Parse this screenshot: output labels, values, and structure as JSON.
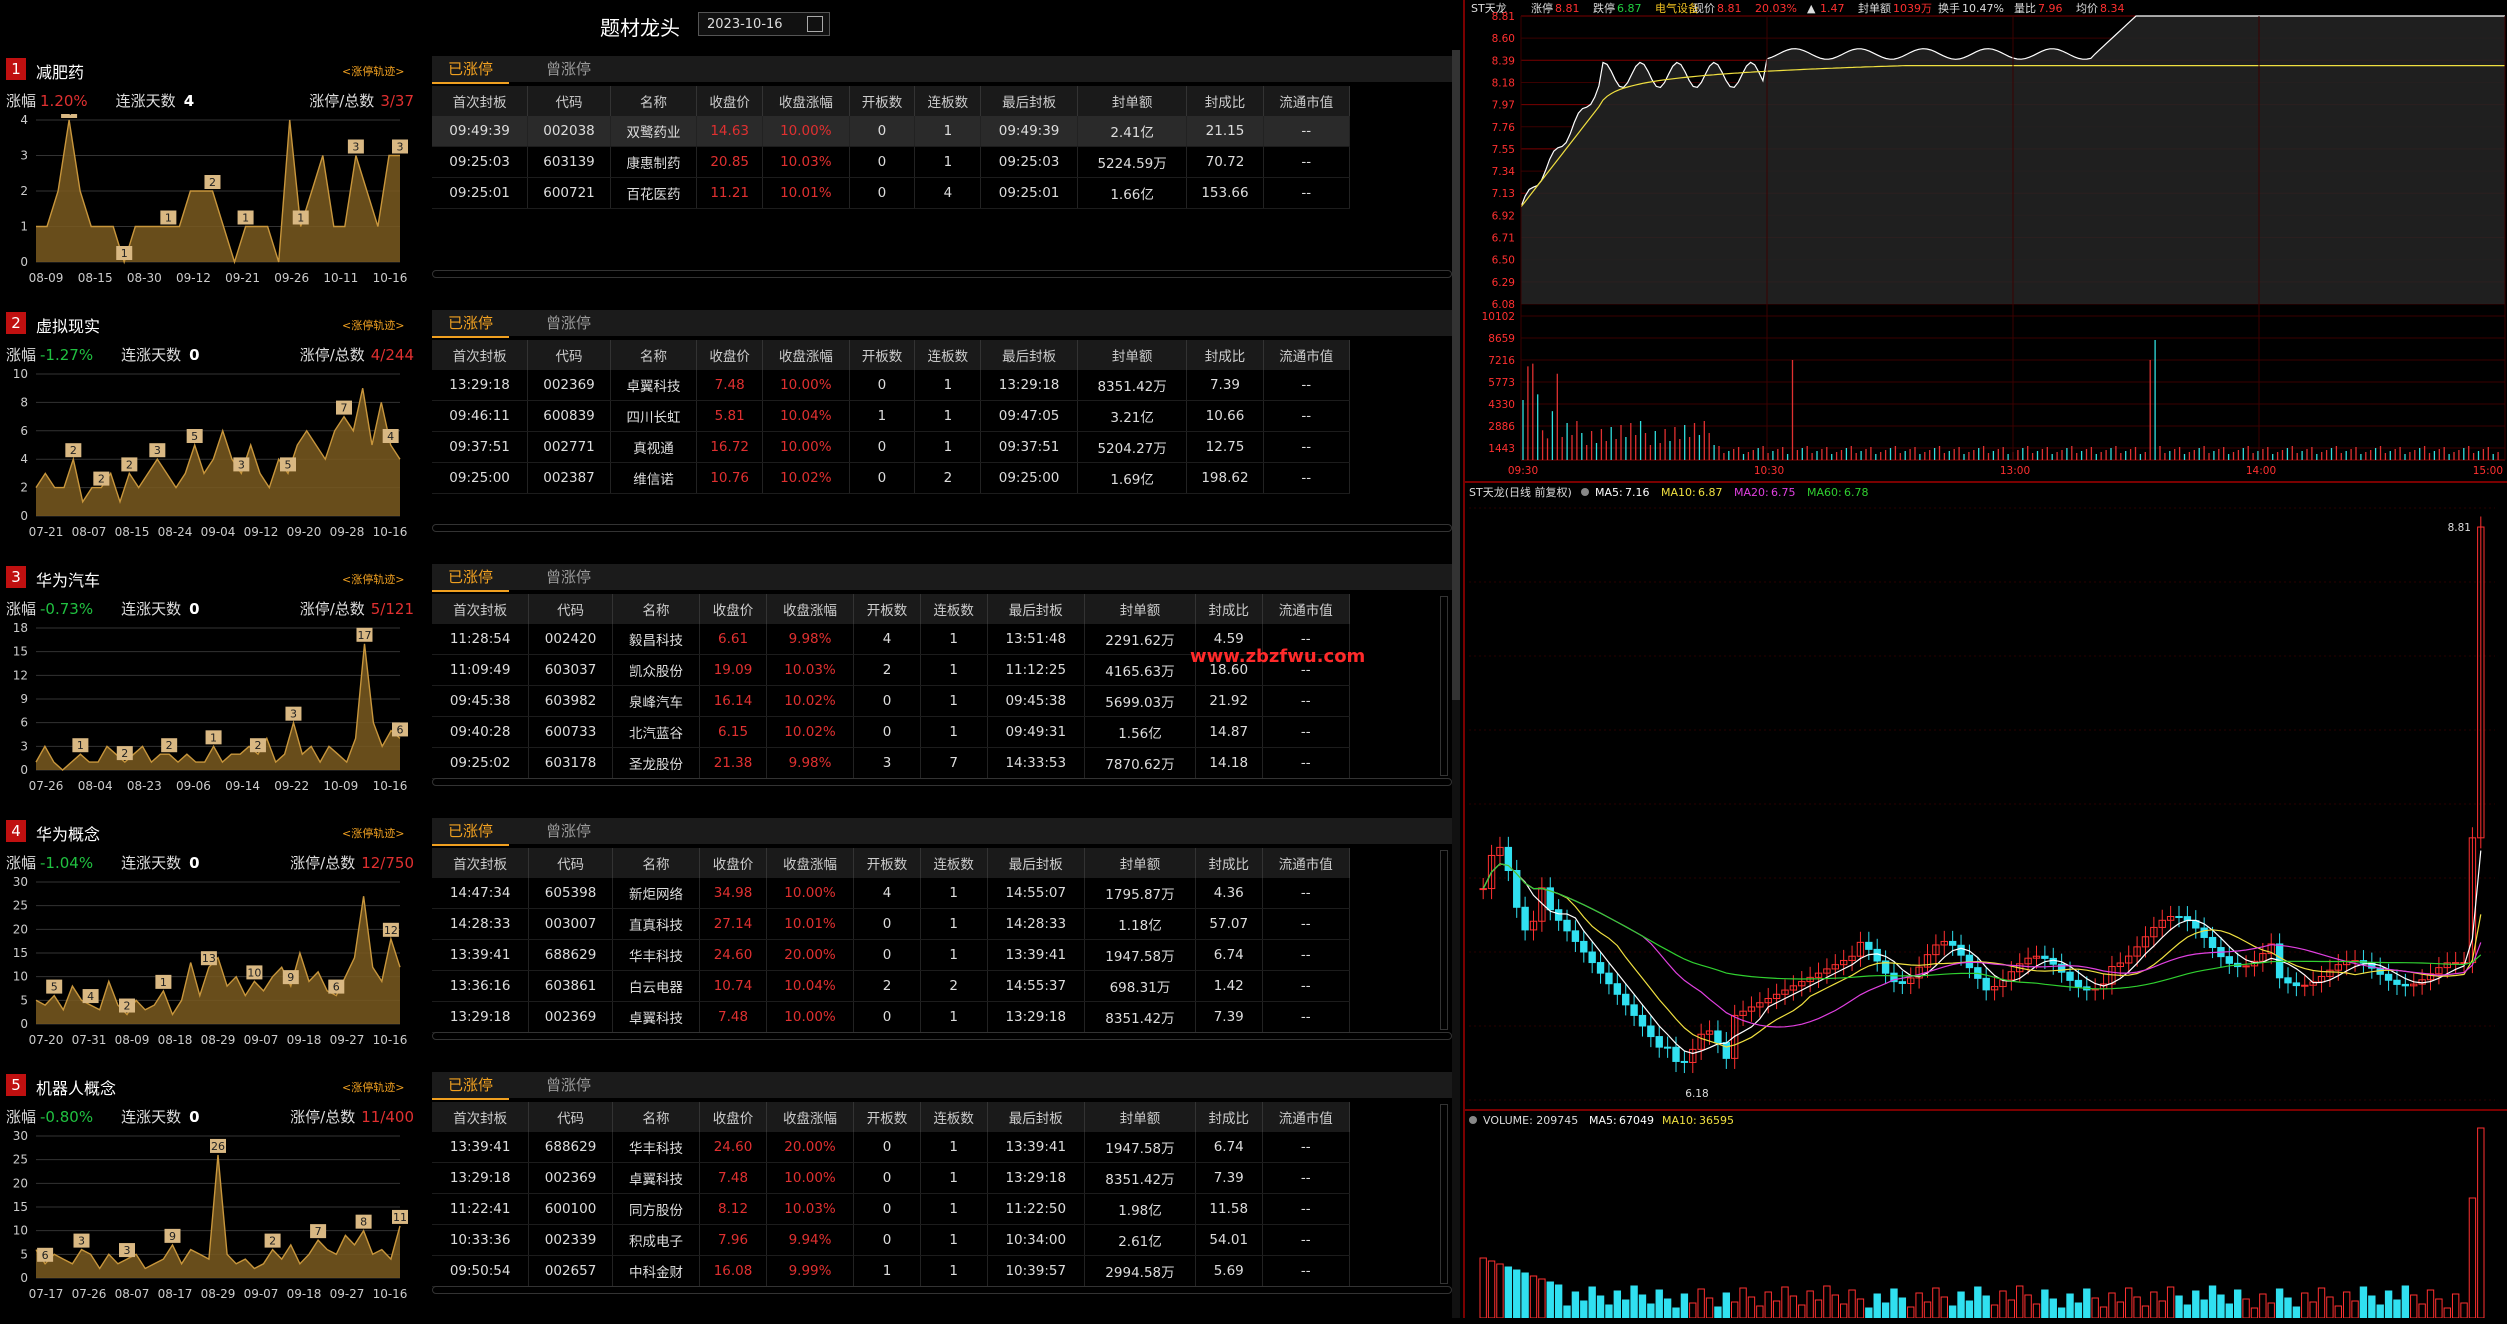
{
  "page": {
    "title": "题材龙头",
    "date": "2023-10-16"
  },
  "tabs": {
    "active": "已涨停",
    "inactive": "曾涨停"
  },
  "track_label": "<涨停轨迹>",
  "labels": {
    "chg": "涨幅",
    "days": "连涨天数",
    "ratio": "涨停/总数"
  },
  "table_headers": [
    "首次封板",
    "代码",
    "名称",
    "收盘价",
    "收盘涨幅",
    "开板数",
    "连板数",
    "最后封板",
    "封单额",
    "封成比",
    "流通市值"
  ],
  "concepts": [
    {
      "rank": "1",
      "name": "减肥药",
      "chg": "1.20%",
      "chg_dir": "up",
      "days": "4",
      "ratio": "3/37",
      "mini": {
        "ylim": [
          0,
          4
        ],
        "yticks": [
          "0",
          "1",
          "2",
          "3",
          "4"
        ],
        "xticks": [
          "08-09",
          "08-15",
          "08-30",
          "09-12",
          "09-21",
          "09-26",
          "10-11",
          "10-16"
        ],
        "values": [
          1,
          1,
          2,
          4,
          2,
          1,
          1,
          1,
          0,
          1,
          1,
          1,
          1,
          1,
          2,
          2,
          2,
          1,
          0,
          1,
          1,
          1,
          0,
          4,
          1,
          2,
          3,
          1,
          1,
          3,
          2,
          1,
          3,
          3
        ],
        "marks": [
          {
            "i": 3,
            "v": "4"
          },
          {
            "i": 8,
            "v": "1"
          },
          {
            "i": 12,
            "v": "1"
          },
          {
            "i": 16,
            "v": "2"
          },
          {
            "i": 19,
            "v": "1"
          },
          {
            "i": 24,
            "v": "1"
          },
          {
            "i": 29,
            "v": "3"
          },
          {
            "i": 33,
            "v": "3"
          }
        ]
      },
      "rows": [
        [
          "09:49:39",
          "002038",
          "双鹭药业",
          "14.63",
          "10.00%",
          "0",
          "1",
          "09:49:39",
          "2.41亿",
          "21.15",
          "--"
        ],
        [
          "09:25:03",
          "603139",
          "康惠制药",
          "20.85",
          "10.03%",
          "0",
          "1",
          "09:25:03",
          "5224.59万",
          "70.72",
          "--"
        ],
        [
          "09:25:01",
          "600721",
          "百花医药",
          "11.21",
          "10.01%",
          "0",
          "4",
          "09:25:01",
          "1.66亿",
          "153.66",
          "--"
        ]
      ]
    },
    {
      "rank": "2",
      "name": "虚拟现实",
      "chg": "-1.27%",
      "chg_dir": "down",
      "days": "0",
      "ratio": "4/244",
      "mini": {
        "ylim": [
          0,
          10
        ],
        "yticks": [
          "0",
          "2",
          "4",
          "6",
          "8",
          "10"
        ],
        "xticks": [
          "07-21",
          "08-07",
          "08-15",
          "08-24",
          "09-04",
          "09-12",
          "09-20",
          "09-28",
          "10-16"
        ],
        "values": [
          2,
          3,
          2,
          2,
          4,
          1,
          2,
          2,
          3,
          1,
          3,
          2,
          3,
          4,
          3,
          2,
          3,
          5,
          3,
          4,
          6,
          4,
          3,
          5,
          3,
          2,
          4,
          3,
          5,
          6,
          5,
          4,
          6,
          7,
          6,
          9,
          5,
          8,
          5,
          4
        ],
        "marks": [
          {
            "i": 4,
            "v": "2"
          },
          {
            "i": 7,
            "v": "2"
          },
          {
            "i": 10,
            "v": "2"
          },
          {
            "i": 13,
            "v": "3"
          },
          {
            "i": 17,
            "v": "5"
          },
          {
            "i": 22,
            "v": "3"
          },
          {
            "i": 27,
            "v": "5"
          },
          {
            "i": 33,
            "v": "7"
          },
          {
            "i": 38,
            "v": "4"
          }
        ]
      },
      "rows": [
        [
          "13:29:18",
          "002369",
          "卓翼科技",
          "7.48",
          "10.00%",
          "0",
          "1",
          "13:29:18",
          "8351.42万",
          "7.39",
          "--"
        ],
        [
          "09:46:11",
          "600839",
          "四川长虹",
          "5.81",
          "10.04%",
          "1",
          "1",
          "09:47:05",
          "3.21亿",
          "10.66",
          "--"
        ],
        [
          "09:37:51",
          "002771",
          "真视通",
          "16.72",
          "10.00%",
          "0",
          "1",
          "09:37:51",
          "5204.27万",
          "12.75",
          "--"
        ],
        [
          "09:25:00",
          "002387",
          "维信诺",
          "10.76",
          "10.02%",
          "0",
          "2",
          "09:25:00",
          "1.69亿",
          "198.62",
          "--"
        ]
      ]
    },
    {
      "rank": "3",
      "name": "华为汽车",
      "chg": "-0.73%",
      "chg_dir": "down",
      "days": "0",
      "ratio": "5/121",
      "mini": {
        "ylim": [
          0,
          18
        ],
        "yticks": [
          "0",
          "3",
          "6",
          "9",
          "12",
          "15",
          "18"
        ],
        "xticks": [
          "07-26",
          "08-04",
          "08-23",
          "09-06",
          "09-14",
          "09-22",
          "10-09",
          "10-16"
        ],
        "values": [
          1,
          3,
          1,
          0,
          1,
          2,
          1,
          1,
          3,
          2,
          1,
          2,
          3,
          1,
          2,
          2,
          1,
          2,
          1,
          1,
          3,
          1,
          2,
          2,
          3,
          2,
          4,
          1,
          2,
          6,
          2,
          3,
          1,
          3,
          2,
          1,
          4,
          16,
          6,
          3,
          5,
          4
        ],
        "marks": [
          {
            "i": 5,
            "v": "1"
          },
          {
            "i": 10,
            "v": "2"
          },
          {
            "i": 15,
            "v": "2"
          },
          {
            "i": 20,
            "v": "1"
          },
          {
            "i": 25,
            "v": "2"
          },
          {
            "i": 29,
            "v": "3"
          },
          {
            "i": 37,
            "v": "17"
          },
          {
            "i": 41,
            "v": "6"
          }
        ]
      },
      "rows": [
        [
          "11:28:54",
          "002420",
          "毅昌科技",
          "6.61",
          "9.98%",
          "4",
          "1",
          "13:51:48",
          "2291.62万",
          "4.59",
          "--"
        ],
        [
          "11:09:49",
          "603037",
          "凯众股份",
          "19.09",
          "10.03%",
          "2",
          "1",
          "11:12:25",
          "4165.63万",
          "18.60",
          "--"
        ],
        [
          "09:45:38",
          "603982",
          "泉峰汽车",
          "16.14",
          "10.02%",
          "0",
          "1",
          "09:45:38",
          "5699.03万",
          "21.92",
          "--"
        ],
        [
          "09:40:28",
          "600733",
          "北汽蓝谷",
          "6.15",
          "10.02%",
          "0",
          "1",
          "09:49:31",
          "1.56亿",
          "14.87",
          "--"
        ],
        [
          "09:25:02",
          "603178",
          "圣龙股份",
          "21.38",
          "9.98%",
          "3",
          "7",
          "14:33:53",
          "7870.62万",
          "14.18",
          "--"
        ]
      ]
    },
    {
      "rank": "4",
      "name": "华为概念",
      "chg": "-1.04%",
      "chg_dir": "down",
      "days": "0",
      "ratio": "12/750",
      "mini": {
        "ylim": [
          0,
          30
        ],
        "yticks": [
          "0",
          "5",
          "10",
          "15",
          "20",
          "25",
          "30"
        ],
        "xticks": [
          "07-20",
          "07-31",
          "08-09",
          "08-18",
          "08-29",
          "09-07",
          "09-18",
          "09-27",
          "10-16"
        ],
        "values": [
          5,
          4,
          6,
          3,
          8,
          5,
          4,
          3,
          9,
          4,
          2,
          5,
          3,
          4,
          7,
          2,
          5,
          13,
          6,
          12,
          14,
          8,
          10,
          6,
          9,
          7,
          10,
          12,
          8,
          15,
          9,
          11,
          7,
          6,
          10,
          14,
          27,
          12,
          9,
          18,
          12
        ],
        "marks": [
          {
            "i": 2,
            "v": "5"
          },
          {
            "i": 6,
            "v": "4"
          },
          {
            "i": 10,
            "v": "2"
          },
          {
            "i": 14,
            "v": "1"
          },
          {
            "i": 19,
            "v": "13"
          },
          {
            "i": 24,
            "v": "10"
          },
          {
            "i": 28,
            "v": "9"
          },
          {
            "i": 33,
            "v": "6"
          },
          {
            "i": 39,
            "v": "12"
          }
        ]
      },
      "rows": [
        [
          "14:47:34",
          "605398",
          "新炬网络",
          "34.98",
          "10.00%",
          "4",
          "1",
          "14:55:07",
          "1795.87万",
          "4.36",
          "--"
        ],
        [
          "14:28:33",
          "003007",
          "直真科技",
          "27.14",
          "10.01%",
          "0",
          "1",
          "14:28:33",
          "1.18亿",
          "57.07",
          "--"
        ],
        [
          "13:39:41",
          "688629",
          "华丰科技",
          "24.60",
          "20.00%",
          "0",
          "1",
          "13:39:41",
          "1947.58万",
          "6.74",
          "--"
        ],
        [
          "13:36:16",
          "603861",
          "白云电器",
          "10.74",
          "10.04%",
          "2",
          "2",
          "14:55:37",
          "698.31万",
          "1.42",
          "--"
        ],
        [
          "13:29:18",
          "002369",
          "卓翼科技",
          "7.48",
          "10.00%",
          "0",
          "1",
          "13:29:18",
          "8351.42万",
          "7.39",
          "--"
        ]
      ]
    },
    {
      "rank": "5",
      "name": "机器人概念",
      "chg": "-0.80%",
      "chg_dir": "down",
      "days": "0",
      "ratio": "11/400",
      "mini": {
        "ylim": [
          0,
          30
        ],
        "yticks": [
          "0",
          "5",
          "10",
          "15",
          "20",
          "25",
          "30"
        ],
        "xticks": [
          "07-17",
          "07-26",
          "08-07",
          "08-17",
          "08-29",
          "09-07",
          "09-18",
          "09-27",
          "10-16"
        ],
        "values": [
          6,
          3,
          5,
          4,
          3,
          6,
          5,
          2,
          5,
          3,
          4,
          5,
          2,
          3,
          4,
          7,
          3,
          6,
          5,
          4,
          26,
          5,
          3,
          4,
          2,
          3,
          6,
          4,
          7,
          3,
          5,
          8,
          6,
          5,
          9,
          7,
          10,
          5,
          6,
          4,
          11
        ],
        "marks": [
          {
            "i": 1,
            "v": "6"
          },
          {
            "i": 5,
            "v": "3"
          },
          {
            "i": 10,
            "v": "3"
          },
          {
            "i": 15,
            "v": "9"
          },
          {
            "i": 20,
            "v": "26"
          },
          {
            "i": 26,
            "v": "2"
          },
          {
            "i": 31,
            "v": "7"
          },
          {
            "i": 36,
            "v": "8"
          },
          {
            "i": 40,
            "v": "11"
          }
        ]
      },
      "rows": [
        [
          "13:39:41",
          "688629",
          "华丰科技",
          "24.60",
          "20.00%",
          "0",
          "1",
          "13:39:41",
          "1947.58万",
          "6.74",
          "--"
        ],
        [
          "13:29:18",
          "002369",
          "卓翼科技",
          "7.48",
          "10.00%",
          "0",
          "1",
          "13:29:18",
          "8351.42万",
          "7.39",
          "--"
        ],
        [
          "11:22:41",
          "600100",
          "同方股份",
          "8.12",
          "10.03%",
          "0",
          "1",
          "11:22:50",
          "1.98亿",
          "11.58",
          "--"
        ],
        [
          "10:33:36",
          "002339",
          "积成电子",
          "7.96",
          "9.94%",
          "0",
          "1",
          "10:34:00",
          "2.61亿",
          "54.01",
          "--"
        ],
        [
          "09:50:54",
          "002657",
          "中科金财",
          "16.08",
          "9.99%",
          "1",
          "1",
          "10:39:57",
          "2994.58万",
          "5.69",
          "--"
        ]
      ]
    }
  ],
  "intraday": {
    "name": "ST天龙",
    "items": [
      {
        "k": "涨停",
        "v": "8.81",
        "c": "#ff3030"
      },
      {
        "k": "跌停",
        "v": "6.87",
        "c": "#20d040"
      },
      {
        "k": "",
        "v": "电气设备",
        "c": "#f0c020"
      },
      {
        "k": "现价",
        "v": "8.81",
        "c": "#ff3030"
      },
      {
        "k": "",
        "v": "20.03%",
        "c": "#ff3030"
      },
      {
        "k": "▲",
        "v": "1.47",
        "c": "#ff3030"
      },
      {
        "k": "封单额",
        "v": "1039万",
        "c": "#ff3030"
      },
      {
        "k": "换手",
        "v": "10.47%",
        "c": "#ddd"
      },
      {
        "k": "量比",
        "v": "7.96",
        "c": "#ff3030"
      },
      {
        "k": "均价",
        "v": "8.34",
        "c": "#ff3030"
      }
    ],
    "price_ticks": [
      "8.81",
      "8.60",
      "8.39",
      "8.18",
      "7.97",
      "7.76",
      "7.55",
      "7.34",
      "7.13",
      "6.92",
      "6.71",
      "6.50",
      "6.29",
      "6.08"
    ],
    "vol_ticks": [
      "10102",
      "8659",
      "7216",
      "5773",
      "4330",
      "2886",
      "1443"
    ],
    "time_ticks": [
      "09:30",
      "10:30",
      "13:00",
      "14:00",
      "15:00"
    ]
  },
  "kline": {
    "title": "ST天龙(日线 前复权)",
    "ma": [
      {
        "k": "MA5:",
        "v": "7.16",
        "c": "#ffffff"
      },
      {
        "k": "MA10:",
        "v": "6.87",
        "c": "#f0e040"
      },
      {
        "k": "MA20:",
        "v": "6.75",
        "c": "#e040e0"
      },
      {
        "k": "MA60:",
        "v": "6.78",
        "c": "#30d030"
      }
    ],
    "high_label": "8.81",
    "low_label": "6.18",
    "volume_title": "VOLUME: 209745",
    "vol_ma": [
      {
        "k": "MA5:",
        "v": "67049",
        "c": "#ffffff"
      },
      {
        "k": "MA10:",
        "v": "36595",
        "c": "#f0e040"
      }
    ]
  },
  "watermark": "www.zbzfwu.com",
  "colors": {
    "up": "#e03030",
    "down": "#20c040",
    "accent": "#f0a020",
    "mini_fill": "#7a5a20",
    "mini_line": "#c8963c"
  }
}
